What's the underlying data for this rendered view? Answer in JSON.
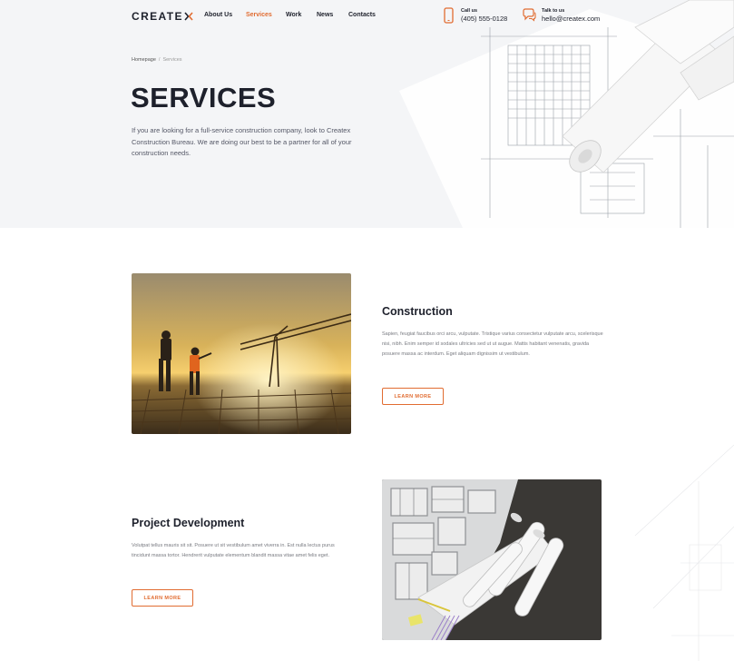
{
  "header": {
    "logo_text": "CREATE",
    "nav": [
      {
        "label": "About Us",
        "active": false
      },
      {
        "label": "Services",
        "active": true
      },
      {
        "label": "Work",
        "active": false
      },
      {
        "label": "News",
        "active": false
      },
      {
        "label": "Contacts",
        "active": false
      }
    ],
    "call": {
      "label": "Call us",
      "value": "(405) 555-0128",
      "icon": "phone-icon"
    },
    "talk": {
      "label": "Talk to us",
      "value": "hello@createx.com",
      "icon": "chat-icon"
    }
  },
  "breadcrumb": {
    "home": "Homepage",
    "separator": "/",
    "current": "Services"
  },
  "hero": {
    "title": "SERVICES",
    "intro": "If you are looking for a full-service construction company, look to Createx Construction Bureau. We are doing our best to be a partner for all of your construction needs."
  },
  "services": [
    {
      "title": "Construction",
      "text": "Sapien, feugiat faucibus orci arcu, vulputate. Tristique varius consectetur vulputate arcu, scelerisque nisi, nibh. Enim semper id sodales ultricies sed ut ut augue. Mattis habitant venenatis, gravida posuere massa ac interdum. Eget aliquam dignissim ut vestibulum.",
      "button": "LEARN MORE",
      "image": "construction-site-photo"
    },
    {
      "title": "Project Development",
      "text": "Volutpat tellus mauris sit sit. Posuere ut sit vestibulum amet viverra in. Est nulla lectus purus tincidunt massa tortor. Hendrerit vulputate elementum blandit massa vitae amet felis eget.",
      "button": "LEARN MORE",
      "image": "architecture-model-photo"
    }
  ],
  "colors": {
    "accent": "#e16c31",
    "dark": "#1e212c",
    "hero_bg": "#f4f5f7"
  }
}
